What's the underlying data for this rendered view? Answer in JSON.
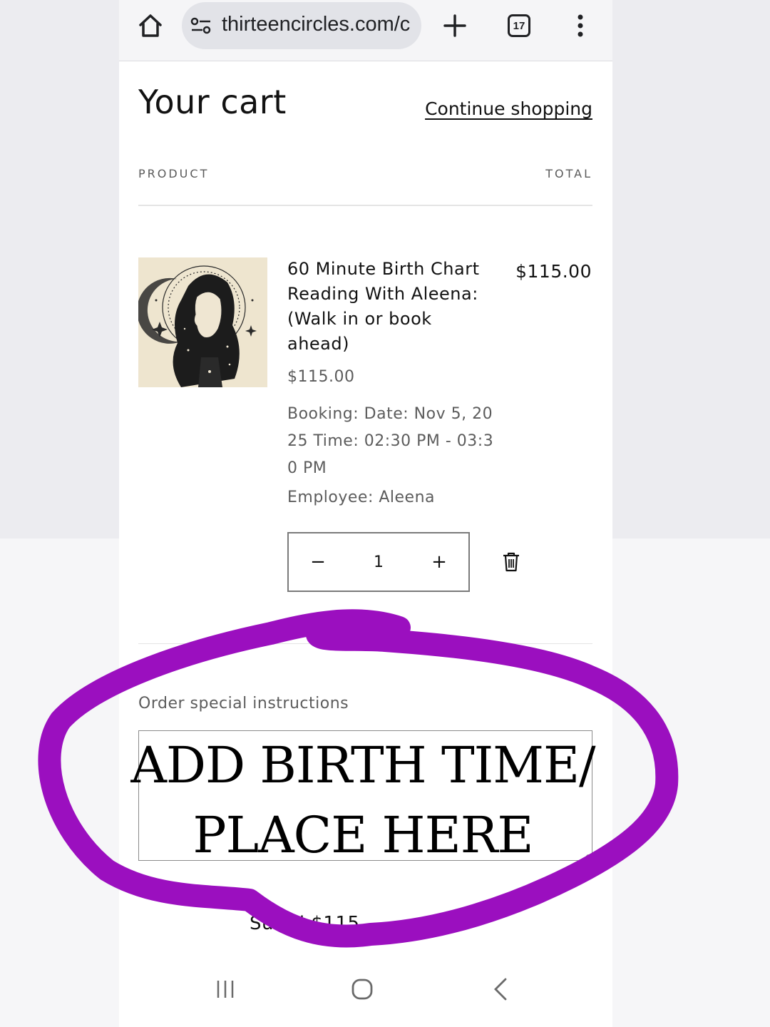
{
  "browser": {
    "url": "thirteencircles.com/c",
    "tab_count": "17"
  },
  "cart": {
    "title": "Your cart",
    "continue_link": "Continue shopping",
    "columns": {
      "product": "PRODUCT",
      "total": "TOTAL"
    },
    "item": {
      "title": "60 Minute Birth Chart Reading With Aleena: (Walk in or book ahead)",
      "total": "$115.00",
      "price": "$115.00",
      "booking": "Booking: Date: Nov 5, 2025 Time: 02:30 PM - 03:30 PM",
      "employee": "Employee: Aleena",
      "quantity": "1",
      "minus_label": "−",
      "plus_label": "+"
    },
    "instructions": {
      "label": "Order special instructions",
      "value": "ADD BIRTH TIME/ PLACE HERE"
    },
    "subtotal_peek": "Su          tal   $115"
  },
  "annotation": {
    "color": "#9b0fbf"
  },
  "icons": [
    "home-icon",
    "site-settings-icon",
    "new-tab-icon",
    "tabs-icon",
    "menu-icon",
    "trash-icon",
    "recents-icon",
    "nav-home-icon",
    "back-icon"
  ]
}
